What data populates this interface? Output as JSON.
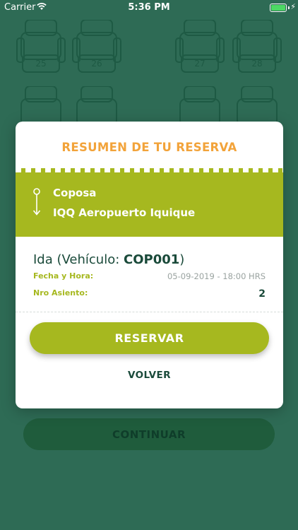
{
  "status_bar": {
    "carrier": "Carrier",
    "time": "5:36 PM"
  },
  "background": {
    "seats": [
      "25",
      "26",
      "27",
      "28"
    ],
    "continue_label": "CONTINUAR"
  },
  "modal": {
    "title": "RESUMEN DE TU RESERVA",
    "route": {
      "from": "Coposa",
      "to": "IQQ Aeropuerto Iquique"
    },
    "trip": {
      "prefix": "Ida (Vehículo: ",
      "vehicle": "COP001",
      "suffix": ")",
      "date_label": "Fecha y Hora:",
      "date_value": "05-09-2019 - 18:00 HRS",
      "seat_label": "Nro Asiento:",
      "seat_value": "2"
    },
    "reservar_label": "RESERVAR",
    "volver_label": "VOLVER"
  },
  "colors": {
    "background": "#2e6b55",
    "accent_green": "#a6b81f",
    "title_orange": "#f2a33a",
    "dark_text": "#1a4a3a"
  }
}
